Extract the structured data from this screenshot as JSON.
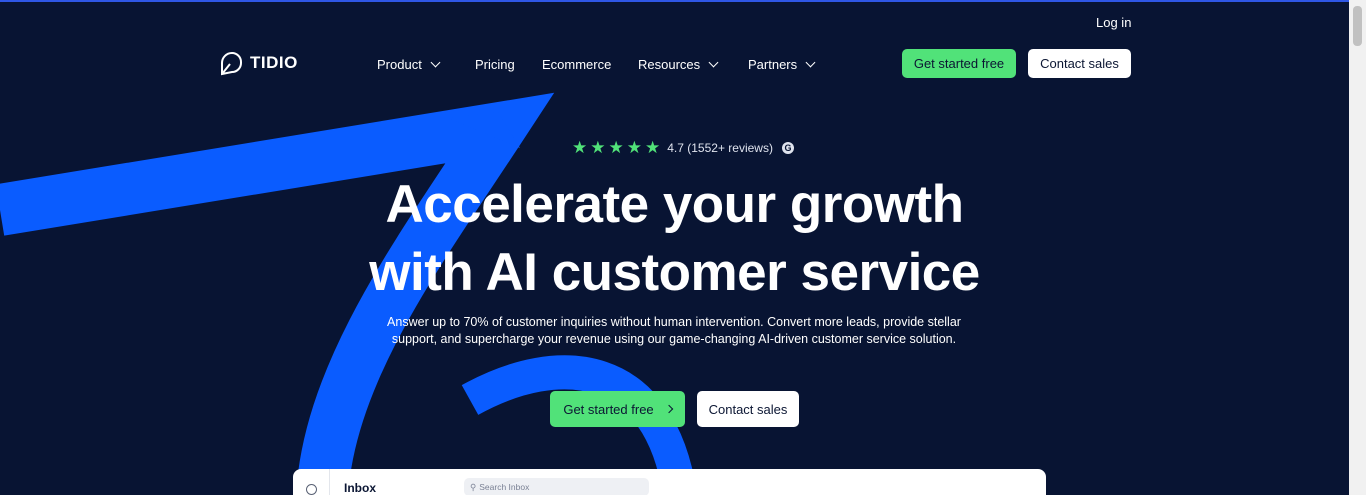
{
  "nav": {
    "login": "Log in",
    "logo_text": "TIDIO",
    "items": [
      {
        "label": "Product",
        "has_dropdown": true
      },
      {
        "label": "Pricing",
        "has_dropdown": false
      },
      {
        "label": "Ecommerce",
        "has_dropdown": false
      },
      {
        "label": "Resources",
        "has_dropdown": true
      },
      {
        "label": "Partners",
        "has_dropdown": true
      }
    ],
    "get_started": "Get started free",
    "contact_sales": "Contact sales"
  },
  "hero": {
    "rating_value": "4.7 (1552+ reviews)",
    "stars": 5,
    "review_source_icon": "g2-icon",
    "headline_line1": "Accelerate your growth",
    "headline_line2": "with AI customer service",
    "subtitle": "Answer up to 70% of customer inquiries without human intervention. Convert more leads, provide stellar support, and supercharge your revenue using our game-changing AI-driven customer service solution.",
    "cta_primary": "Get started free",
    "cta_secondary": "Contact sales"
  },
  "preview": {
    "title": "Inbox",
    "search_placeholder": "Search Inbox"
  },
  "colors": {
    "background": "#081433",
    "accent_green": "#51e279",
    "swoosh_blue": "#0a5cff"
  }
}
